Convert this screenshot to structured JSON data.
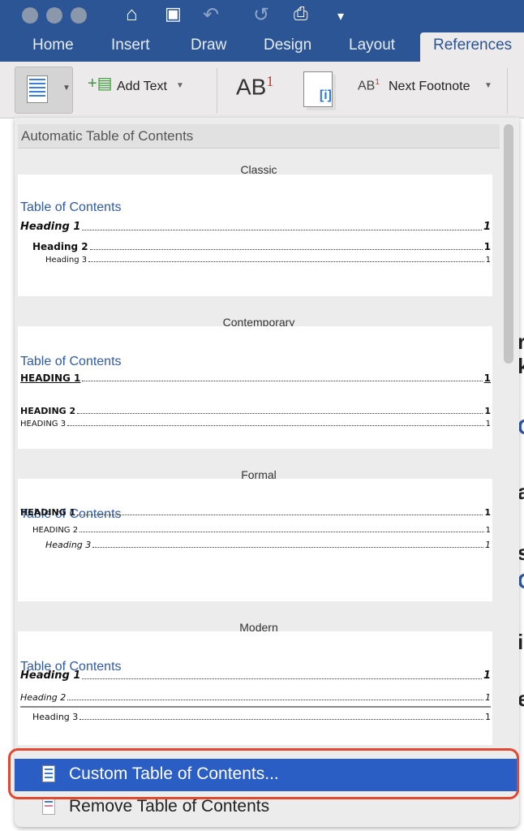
{
  "toolbar": {
    "icons": [
      "close",
      "minimize",
      "zoom",
      "home-icon",
      "save-icon",
      "undo-icon",
      "redo-icon",
      "print-icon",
      "customize-icon"
    ]
  },
  "tabs": [
    "Home",
    "Insert",
    "Draw",
    "Design",
    "Layout",
    "References"
  ],
  "active_tab": "References",
  "ribbon": {
    "add_text": "Add Text",
    "next_footnote": "Next Footnote",
    "insert_footnote": "AB",
    "footnote_sup": "1"
  },
  "panel": {
    "header": "Automatic Table of Contents",
    "styles": [
      {
        "label": "Classic",
        "title": "Table of Contents",
        "rows": [
          {
            "text": "Heading 1",
            "page": "1"
          },
          {
            "text": "Heading 2",
            "page": "1"
          },
          {
            "text": "Heading 3",
            "page": "1"
          }
        ]
      },
      {
        "label": "Contemporary",
        "title": "Table of Contents",
        "rows": [
          {
            "text": "HEADING 1",
            "page": "1"
          },
          {
            "text": "HEADING 2",
            "page": "1"
          },
          {
            "text": "HEADING 3",
            "page": "1"
          }
        ]
      },
      {
        "label": "Formal",
        "title": "Table of Contents",
        "rows": [
          {
            "text": "HEADING 1",
            "page": "1"
          },
          {
            "text": "HEADING 2",
            "page": "1"
          },
          {
            "text": "Heading 3",
            "page": "1"
          }
        ]
      },
      {
        "label": "Modern",
        "title": "Table of Contents",
        "rows": [
          {
            "text": "Heading 1",
            "page": "1"
          },
          {
            "text": "Heading 2",
            "page": "1"
          },
          {
            "text": "Heading 3",
            "page": "1"
          }
        ]
      }
    ],
    "custom": "Custom Table of Contents...",
    "remove": "Remove Table of Contents"
  },
  "colors": {
    "titlebar": "#2c5595",
    "highlight": "#2a5ec4",
    "callout": "#e2472f",
    "toc_title": "#2e5aa4"
  }
}
